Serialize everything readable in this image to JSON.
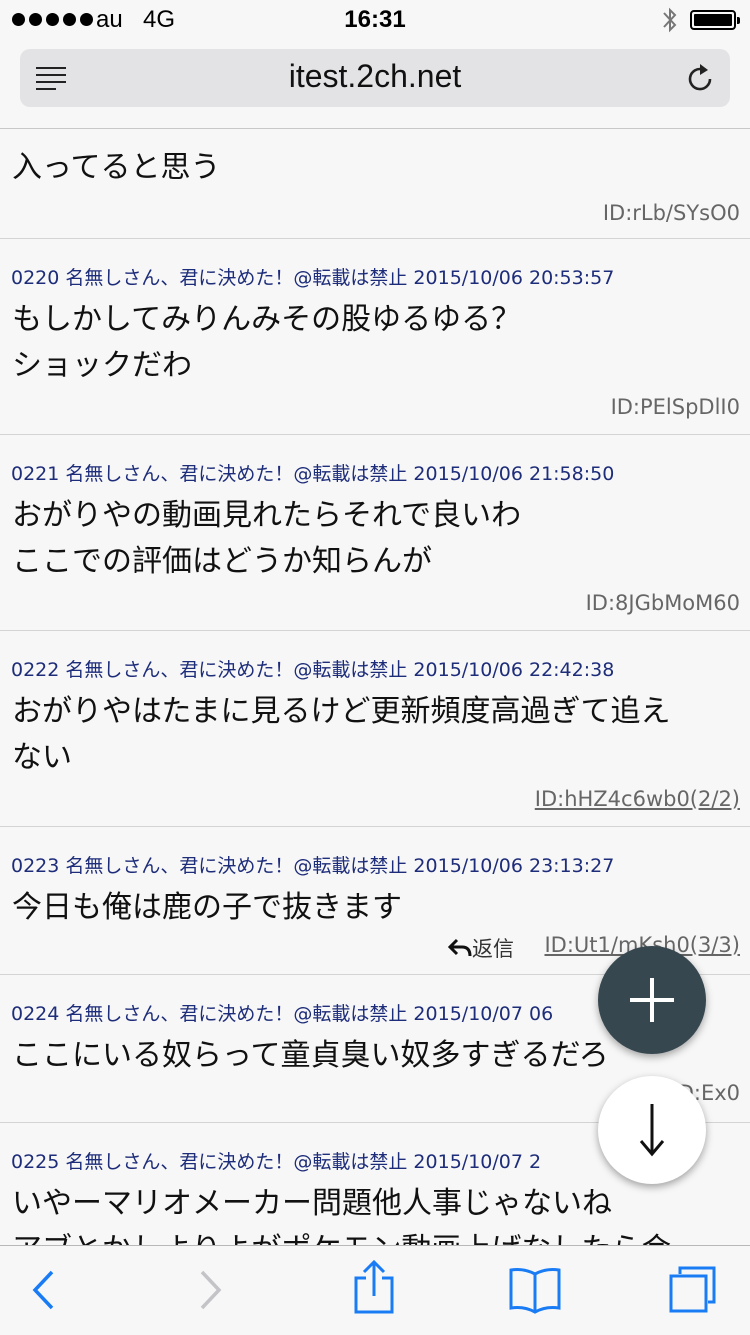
{
  "status_bar": {
    "carrier": "au",
    "network": "4G",
    "time": "16:31"
  },
  "browser": {
    "url": "itest.2ch.net"
  },
  "partial_post": {
    "body_line": "入ってると思う",
    "id": "ID:rLb/SYsO0"
  },
  "posts": [
    {
      "header": "0220 名無しさん、君に決めた！@転載は禁止 2015/10/06 20:53:57",
      "lines": [
        "もしかしてみりんみその股ゆるゆる？",
        "ショックだわ"
      ],
      "id": "ID:PElSpDlI0"
    },
    {
      "header": "0221 名無しさん、君に決めた！@転載は禁止 2015/10/06 21:58:50",
      "lines": [
        "おがりやの動画見れたらそれで良いわ",
        "ここでの評価はどうか知らんが"
      ],
      "id": "ID:8JGbMoM60"
    },
    {
      "header": "0222 名無しさん、君に決めた！@転載は禁止 2015/10/06 22:42:38",
      "lines": [
        "おがりやはたまに見るけど更新頻度高過ぎて追え",
        "ない"
      ],
      "id": "ID:hHZ4c6wb0(2/2)"
    },
    {
      "header": "0223 名無しさん、君に決めた！@転載は禁止 2015/10/06 23:13:27",
      "lines": [
        "今日も俺は鹿の子で抜きます"
      ],
      "reply": "返信",
      "id": "ID:Ut1/mKsh0(3/3)"
    },
    {
      "header": "0224 名無しさん、君に決めた！@転載は禁止 2015/10/07 06",
      "lines": [
        "ここにいる奴らって童貞臭い奴多すぎるだろ"
      ],
      "id": "ID:Ex0"
    },
    {
      "header": "0225 名無しさん、君に決めた！@転載は禁止 2015/10/07 2",
      "lines": [
        "いやーマリオメーカー問題他人事じゃないね",
        "アブとかしよりよがポケモン動画上げなしたら会"
      ]
    }
  ],
  "colors": {
    "header_text": "#1e2d7a",
    "ios_blue": "#1a7cf5",
    "fab_dark": "#37474f"
  },
  "icons": {
    "reader": "reader-view-icon",
    "reload": "reload-icon",
    "back": "back-chevron-icon",
    "forward": "forward-chevron-icon",
    "share": "share-icon",
    "bookmarks": "bookmarks-icon",
    "tabs": "tabs-icon",
    "plus": "plus-icon",
    "down": "arrow-down-icon",
    "reply": "reply-arrow-icon"
  }
}
